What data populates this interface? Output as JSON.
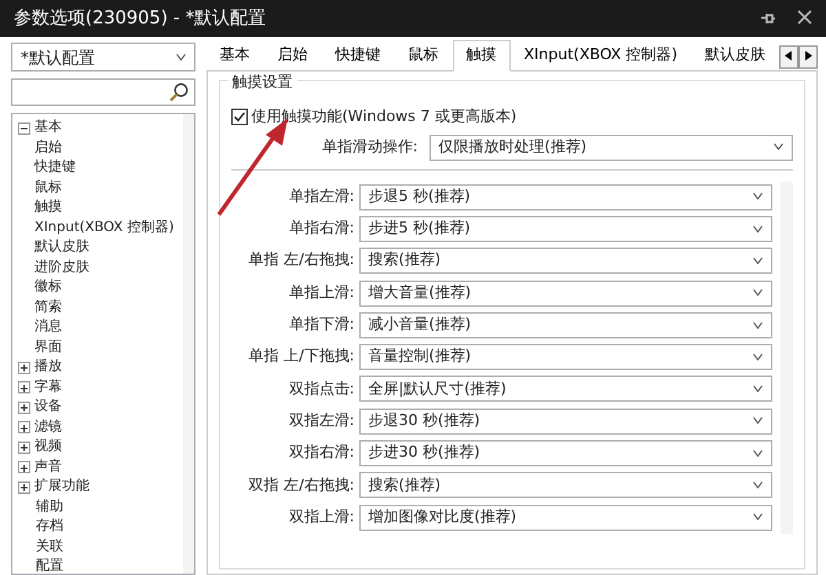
{
  "window": {
    "title": "参数选项(230905) - *默认配置"
  },
  "profile": {
    "value": "*默认配置"
  },
  "tree": [
    {
      "label": "基本",
      "expanded": true,
      "children": [
        {
          "label": "启始"
        },
        {
          "label": "快捷键"
        },
        {
          "label": "鼠标"
        },
        {
          "label": "触摸"
        },
        {
          "label": "XInput(XBOX 控制器)"
        },
        {
          "label": "默认皮肤"
        },
        {
          "label": "进阶皮肤"
        },
        {
          "label": "徽标"
        },
        {
          "label": "简索"
        },
        {
          "label": "消息"
        },
        {
          "label": "界面"
        }
      ]
    },
    {
      "label": "播放",
      "expanded": false
    },
    {
      "label": "字幕",
      "expanded": false
    },
    {
      "label": "设备",
      "expanded": false
    },
    {
      "label": "滤镜",
      "expanded": false
    },
    {
      "label": "视频",
      "expanded": false
    },
    {
      "label": "声音",
      "expanded": false
    },
    {
      "label": "扩展功能",
      "expanded": false
    },
    {
      "label": "辅助"
    },
    {
      "label": "存档"
    },
    {
      "label": "关联"
    },
    {
      "label": "配置"
    }
  ],
  "tabs": [
    {
      "label": "基本",
      "selected": false
    },
    {
      "label": "启始",
      "selected": false
    },
    {
      "label": "快捷键",
      "selected": false
    },
    {
      "label": "鼠标",
      "selected": false
    },
    {
      "label": "触摸",
      "selected": true
    },
    {
      "label": "XInput(XBOX 控制器)",
      "selected": false
    },
    {
      "label": "默认皮肤",
      "selected": false
    }
  ],
  "group": {
    "title": "触摸设置",
    "enable": {
      "label": "使用触摸功能(Windows 7 或更高版本)",
      "checked": true
    },
    "single_swipe": {
      "label": "单指滑动操作:",
      "value": "仅限播放时处理(推荐)"
    },
    "gestures": [
      {
        "label": "单指左滑:",
        "value": "步退5 秒(推荐)"
      },
      {
        "label": "单指右滑:",
        "value": "步进5 秒(推荐)"
      },
      {
        "label": "单指 左/右拖拽:",
        "value": "搜索(推荐)"
      },
      {
        "label": "单指上滑:",
        "value": "增大音量(推荐)"
      },
      {
        "label": "单指下滑:",
        "value": "减小音量(推荐)"
      },
      {
        "label": "单指 上/下拖拽:",
        "value": "音量控制(推荐)"
      },
      {
        "label": "双指点击:",
        "value": "全屏|默认尺寸(推荐)"
      },
      {
        "label": "双指左滑:",
        "value": "步退30 秒(推荐)"
      },
      {
        "label": "双指右滑:",
        "value": "步进30 秒(推荐)"
      },
      {
        "label": "双指 左/右拖拽:",
        "value": "搜索(推荐)"
      },
      {
        "label": "双指上滑:",
        "value": "增加图像对比度(推荐)"
      }
    ]
  }
}
